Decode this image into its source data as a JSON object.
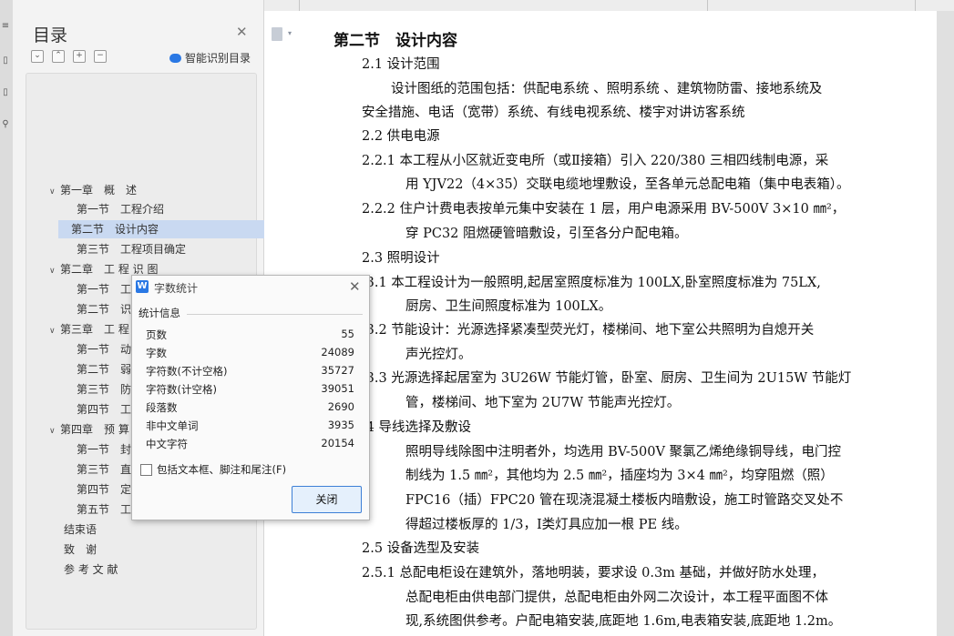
{
  "toc": {
    "title": "目录",
    "ai_button": "智能识别目录",
    "tools": [
      "⌄",
      "⌃",
      "+",
      "−"
    ],
    "items": [
      {
        "label": "第一章　概　述",
        "level": 0,
        "expanded": true
      },
      {
        "label": "第一节　工程介绍",
        "level": 1
      },
      {
        "label": "第二节　设计内容",
        "level": 1,
        "selected": true
      },
      {
        "label": "第三节　工程项目确定",
        "level": 1
      },
      {
        "label": "第二章　工 程 识 图",
        "level": 0,
        "expanded": true
      },
      {
        "label": "第一节　工程",
        "level": 1
      },
      {
        "label": "第二节　识图",
        "level": 1
      },
      {
        "label": "第三章　工 程 量",
        "level": 0,
        "expanded": true
      },
      {
        "label": "第一节　动力",
        "level": 1
      },
      {
        "label": "第二节　弱电",
        "level": 1
      },
      {
        "label": "第三节　防雷",
        "level": 1
      },
      {
        "label": "第四节　工程",
        "level": 1
      },
      {
        "label": "第四章　预 算 书",
        "level": 0,
        "expanded": true
      },
      {
        "label": "第一节　封面",
        "level": 1
      },
      {
        "label": "第三节　直接",
        "level": 1
      },
      {
        "label": "第四节　定额",
        "level": 1
      },
      {
        "label": "第五节　工程",
        "level": 1
      },
      {
        "label": "结束语",
        "level": 0
      },
      {
        "label": "致　谢",
        "level": 0
      },
      {
        "label": "参 考 文 献",
        "level": 0
      }
    ]
  },
  "document": {
    "lines": [
      "第二节　设计内容",
      "2.1 设计范围",
      "设计图纸的范围包括：供配电系统 、照明系统 、建筑物防雷、接地系统及",
      "安全措施、电话（宽带）系统、有线电视系统、楼宇对讲访客系统",
      "2.2 供电电源",
      "2.2.1 本工程从小区就近变电所（或Ⅱ接箱）引入 220/380 三相四线制电源，采",
      "用 YJV22（4×35）交联电缆地埋敷设，至各单元总配电箱（集中电表箱）。",
      "2.2.2 住户计费电表按单元集中安装在 1 层，用户电源采用 BV-500V 3×10 ㎜²，",
      "穿 PC32 阻燃硬管暗敷设，引至各分户配电箱。",
      "2.3 照明设计",
      ".3.1 本工程设计为一般照明,起居室照度标准为 100LX,卧室照度标准为 75LX,",
      "厨房、卫生间照度标准为 100LX。",
      ".3.2 节能设计：光源选择紧凑型荧光灯，楼梯间、地下室公共照明为自熄开关",
      "声光控灯。",
      ".3.3 光源选择起居室为 3U26W 节能灯管，卧室、厨房、卫生间为 2U15W 节能灯",
      "管，楼梯间、地下室为 2U7W 节能声光控灯。",
      ".4 导线选择及敷设",
      "照明导线除图中注明者外，均选用 BV-500V 聚氯乙烯绝缘铜导线，电门控",
      "制线为 1.5 ㎜²，其他均为 2.5 ㎜²，插座均为 3×4 ㎜²，均穿阻燃（照）",
      "FPC16（插）FPC20 管在现浇混凝土楼板内暗敷设，施工时管路交叉处不",
      "得超过楼板厚的 1/3，Ⅰ类灯具应加一根 PE 线。",
      "2.5 设备选型及安装",
      "2.5.1 总配电柜设在建筑外，落地明装，要求设 0.3m 基础，并做好防水处理，",
      "总配电柜由供电部门提供，总配电柜由外网二次设计，本工程平面图不体",
      "现,系统图供参考。户配电箱安装,底距地 1.6m,电表箱安装,底距地 1.2m。"
    ]
  },
  "dialog": {
    "title": "字数统计",
    "section": "统计信息",
    "stats": [
      {
        "label": "页数",
        "value": "55"
      },
      {
        "label": "字数",
        "value": "24089"
      },
      {
        "label": "字符数(不计空格)",
        "value": "35727"
      },
      {
        "label": "字符数(计空格)",
        "value": "39051"
      },
      {
        "label": "段落数",
        "value": "2690"
      },
      {
        "label": "非中文单词",
        "value": "3935"
      },
      {
        "label": "中文字符",
        "value": "20154"
      }
    ],
    "checkbox_label": "包括文本框、脚注和尾注(F)",
    "checkbox_checked": false,
    "close_button": "关闭"
  }
}
